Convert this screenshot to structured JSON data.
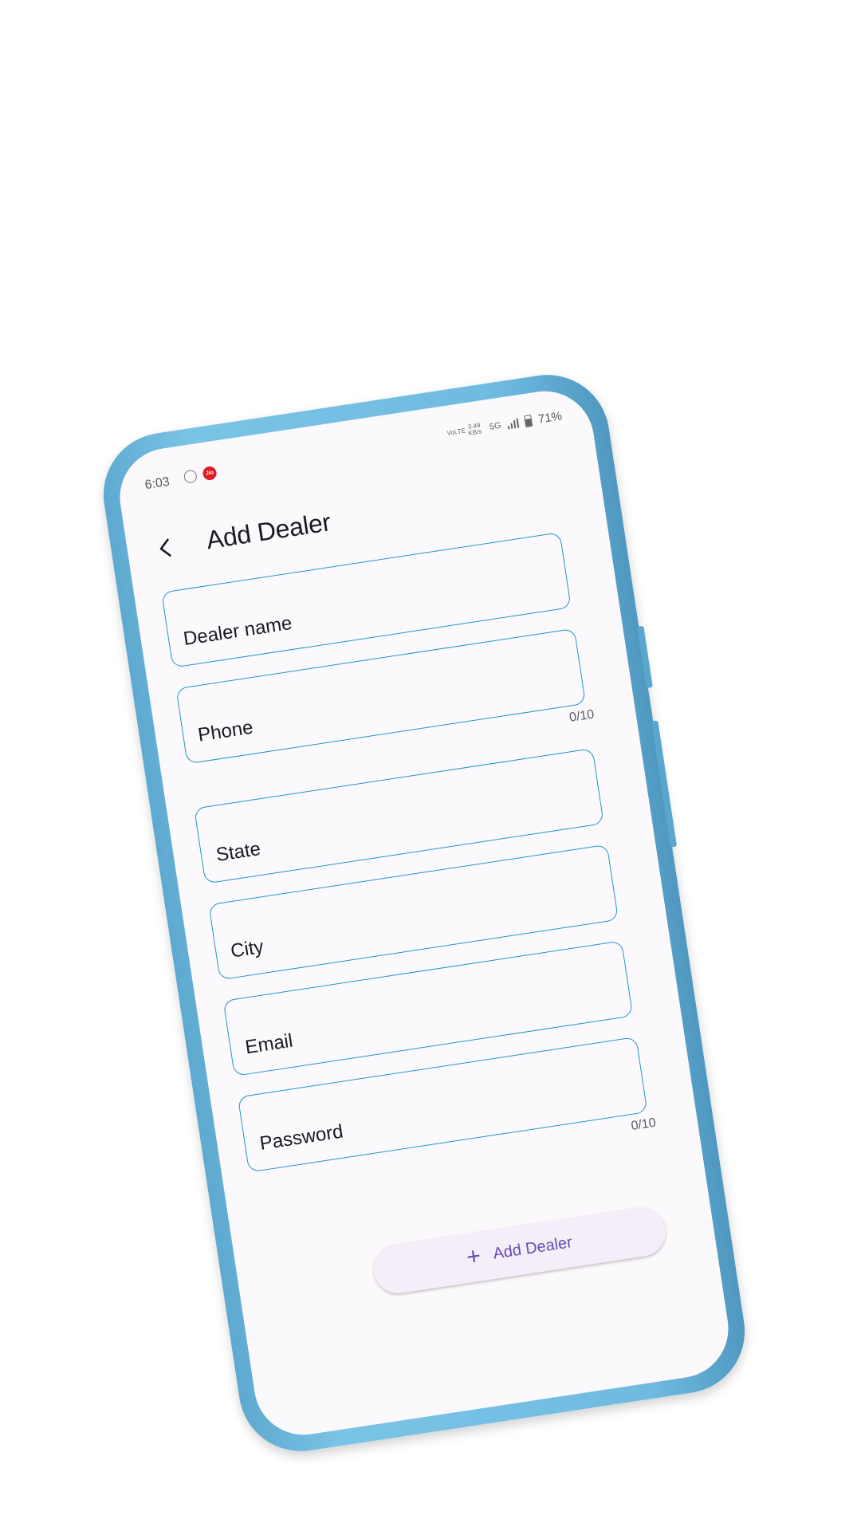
{
  "status_bar": {
    "time": "6:03",
    "volte": "VoLTE",
    "speed": "3.49 KB/s",
    "network": "5G",
    "battery": "71%",
    "icons": [
      "whatsapp-icon",
      "jio-icon",
      "signal-icon",
      "battery-icon"
    ],
    "jio_label": "Jio"
  },
  "app_bar": {
    "title": "Add Dealer",
    "back_icon": "chevron-left-icon"
  },
  "form": {
    "fields": [
      {
        "label": "Dealer name",
        "counter": ""
      },
      {
        "label": "Phone",
        "counter": "0/10"
      },
      {
        "label": "State",
        "counter": ""
      },
      {
        "label": "City",
        "counter": ""
      },
      {
        "label": "Email",
        "counter": ""
      },
      {
        "label": "Password",
        "counter": "0/10"
      }
    ],
    "submit_label": "Add Dealer",
    "submit_icon": "plus-icon"
  },
  "colors": {
    "case": "#6fbbe0",
    "field_border": "#1c96cc",
    "accent": "#6a4bb3",
    "button_bg": "#f3eef8",
    "screen_bg": "#fcf9fc"
  }
}
